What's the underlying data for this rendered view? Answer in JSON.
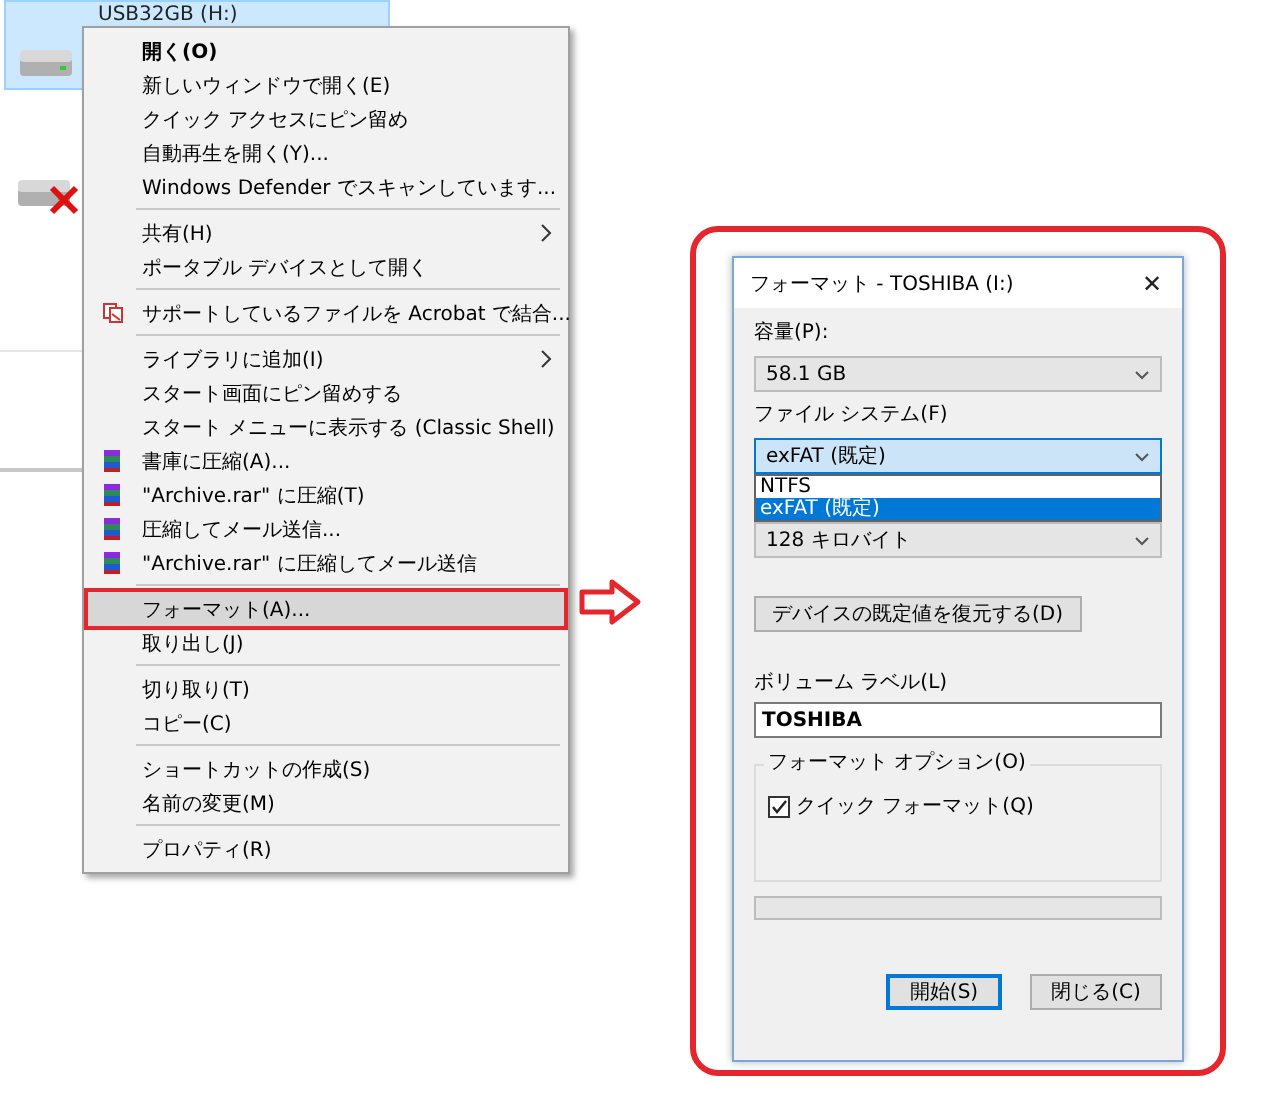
{
  "explorer": {
    "drives": [
      {
        "label": "USB32GB (H:)",
        "selected": true,
        "kind": "usb"
      },
      {
        "kind": "missing",
        "selected": false
      }
    ]
  },
  "context_menu": {
    "items": [
      {
        "kind": "item",
        "label": "開く(O)",
        "bold": true,
        "selected": false
      },
      {
        "kind": "item",
        "label": "新しいウィンドウで開く(E)",
        "selected": false
      },
      {
        "kind": "item",
        "label": "クイック アクセスにピン留め",
        "selected": false
      },
      {
        "kind": "item",
        "label": "自動再生を開く(Y)...",
        "selected": false
      },
      {
        "kind": "item",
        "label": "Windows Defender でスキャンしています...",
        "selected": false
      },
      {
        "kind": "separator"
      },
      {
        "kind": "item",
        "label": "共有(H)",
        "submenu": true,
        "selected": false
      },
      {
        "kind": "item",
        "label": "ポータブル デバイスとして開く",
        "selected": false
      },
      {
        "kind": "separator"
      },
      {
        "kind": "acrobat",
        "label": "サポートしているファイルを Acrobat で結合...",
        "selected": false
      },
      {
        "kind": "separator"
      },
      {
        "kind": "item",
        "label": "ライブラリに追加(I)",
        "submenu": true,
        "selected": false
      },
      {
        "kind": "item",
        "label": "スタート画面にピン留めする",
        "selected": false
      },
      {
        "kind": "item",
        "label": "スタート メニューに表示する (Classic Shell)",
        "selected": false
      },
      {
        "kind": "archive",
        "label": "書庫に圧縮(A)...",
        "selected": false
      },
      {
        "kind": "archive",
        "label": "\"Archive.rar\" に圧縮(T)",
        "selected": false
      },
      {
        "kind": "archive",
        "label": "圧縮してメール送信...",
        "selected": false
      },
      {
        "kind": "archive",
        "label": "\"Archive.rar\" に圧縮してメール送信",
        "selected": false
      },
      {
        "kind": "separator"
      },
      {
        "kind": "item",
        "label": "フォーマット(A)...",
        "selected": true,
        "outlined": true
      },
      {
        "kind": "item",
        "label": "取り出し(J)",
        "selected": false
      },
      {
        "kind": "separator"
      },
      {
        "kind": "item",
        "label": "切り取り(T)",
        "selected": false
      },
      {
        "kind": "item",
        "label": "コピー(C)",
        "selected": false
      },
      {
        "kind": "separator"
      },
      {
        "kind": "item",
        "label": "ショートカットの作成(S)",
        "selected": false
      },
      {
        "kind": "item",
        "label": "名前の変更(M)",
        "selected": false
      },
      {
        "kind": "separator"
      },
      {
        "kind": "item",
        "label": "プロパティ(R)",
        "selected": false
      }
    ]
  },
  "format_dialog": {
    "title": "フォーマット - TOSHIBA (I:)",
    "close": "✕",
    "capacity": {
      "label": "容量(P):",
      "value": "58.1 GB"
    },
    "file_system": {
      "label": "ファイル システム(F)",
      "value": "exFAT (既定)",
      "options": [
        {
          "label": "NTFS",
          "selected": false
        },
        {
          "label": "exFAT (既定)",
          "selected": true
        }
      ]
    },
    "allocation": {
      "value": "128 キロバイト"
    },
    "restore_button": "デバイスの既定値を復元する(D)",
    "volume_label": {
      "label": "ボリューム ラベル(L)",
      "value": "TOSHIBA"
    },
    "options_group": {
      "title": "フォーマット オプション(O)",
      "quick_format": {
        "label": "クイック フォーマット(Q)",
        "checked": true
      }
    },
    "progress": {
      "level": 0
    },
    "buttons": [
      {
        "label": "開始(S)",
        "default": true
      },
      {
        "label": "閉じる(C)",
        "default": false
      }
    ]
  }
}
